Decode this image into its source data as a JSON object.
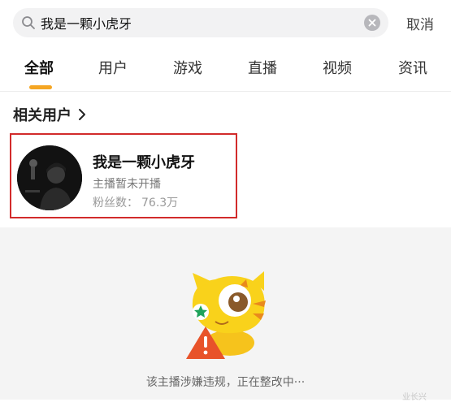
{
  "search": {
    "value": "我是一颗小虎牙",
    "cancel_label": "取消"
  },
  "tabs": [
    {
      "label": "全部",
      "active": true
    },
    {
      "label": "用户",
      "active": false
    },
    {
      "label": "游戏",
      "active": false
    },
    {
      "label": "直播",
      "active": false
    },
    {
      "label": "视频",
      "active": false
    },
    {
      "label": "资讯",
      "active": false
    }
  ],
  "related_users": {
    "title": "相关用户",
    "user": {
      "name": "我是一颗小虎牙",
      "status": "主播暂未开播",
      "fans_label": "粉丝数：",
      "fans_value": "76.3万"
    }
  },
  "empty_state": {
    "message": "该主播涉嫌违规，正在整改中···"
  },
  "watermark": "业长兴",
  "colors": {
    "accent": "#f5a623",
    "highlight_border": "#d22b2b",
    "warning": "#e8532a"
  }
}
